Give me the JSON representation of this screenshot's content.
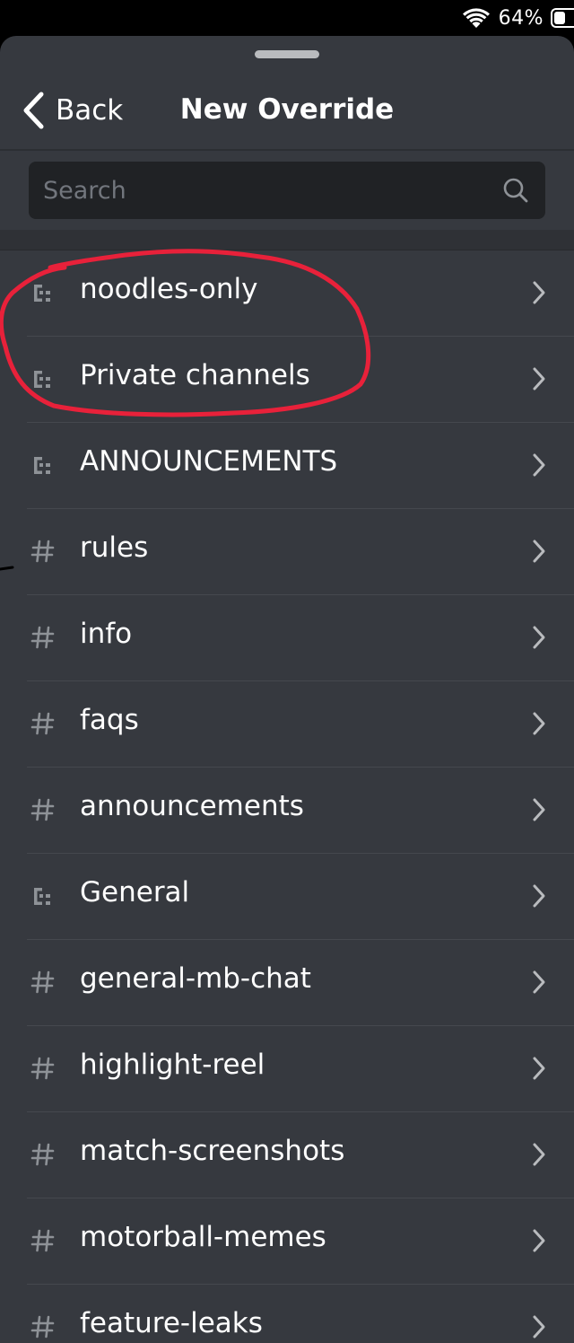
{
  "status_bar": {
    "battery_percent": "64%",
    "battery_level": 0.64,
    "icons": [
      "wifi-icon",
      "battery-icon"
    ]
  },
  "nav": {
    "back_label": "Back",
    "title": "New Override"
  },
  "search": {
    "placeholder": "Search",
    "icon": "search-icon"
  },
  "items": [
    {
      "type": "category",
      "icon": "category-icon",
      "label": "noodles-only"
    },
    {
      "type": "category",
      "icon": "category-icon",
      "label": "Private channels"
    },
    {
      "type": "category",
      "icon": "category-icon",
      "label": "ANNOUNCEMENTS"
    },
    {
      "type": "channel",
      "icon": "hash-icon",
      "label": "rules"
    },
    {
      "type": "channel",
      "icon": "hash-icon",
      "label": "info"
    },
    {
      "type": "channel",
      "icon": "hash-icon",
      "label": "faqs"
    },
    {
      "type": "channel",
      "icon": "hash-icon",
      "label": "announcements"
    },
    {
      "type": "category",
      "icon": "category-icon",
      "label": "General"
    },
    {
      "type": "channel",
      "icon": "hash-icon",
      "label": "general-mb-chat"
    },
    {
      "type": "channel",
      "icon": "hash-icon",
      "label": "highlight-reel"
    },
    {
      "type": "channel",
      "icon": "hash-icon",
      "label": "match-screenshots"
    },
    {
      "type": "channel",
      "icon": "hash-icon",
      "label": "motorball-memes"
    },
    {
      "type": "channel",
      "icon": "hash-icon",
      "label": "feature-leaks"
    }
  ],
  "colors": {
    "sheet_background": "#36393f",
    "search_background": "#202225",
    "text_primary": "#ffffff",
    "icon_muted": "#8e9297",
    "annotation_red": "#e8213a"
  }
}
